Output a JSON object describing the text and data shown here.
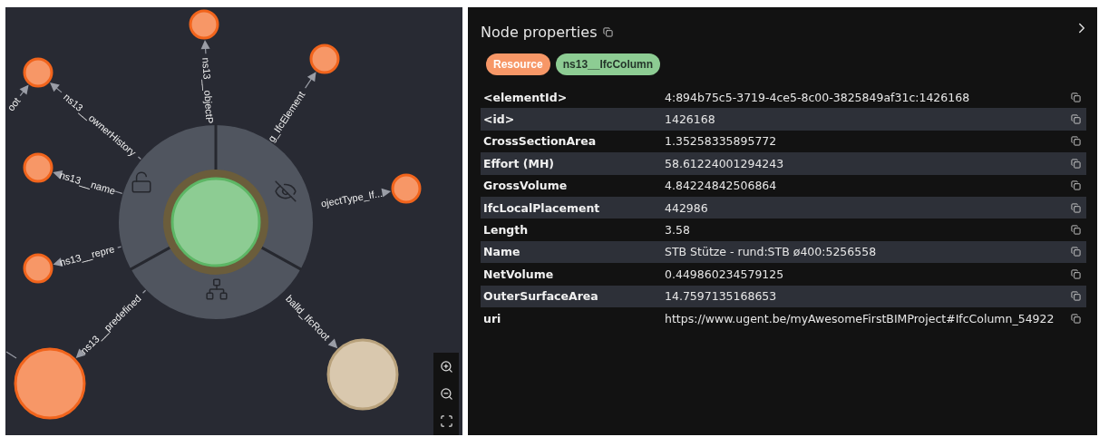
{
  "graph": {
    "center_node": {
      "color": "#8dcc93"
    },
    "nodes": [
      {
        "color": "#f79767"
      },
      {
        "color": "#f79767"
      },
      {
        "color": "#f79767"
      },
      {
        "color": "#f79767"
      },
      {
        "color": "#f79767"
      },
      {
        "color": "#f79767"
      },
      {
        "color": "#f79767"
      },
      {
        "color": "#d9c8ae"
      }
    ],
    "edges": [
      {
        "label": "ns13__objectP"
      },
      {
        "label": "g_IfcElement"
      },
      {
        "label": "ns13__ownerHistory"
      },
      {
        "label": "oot"
      },
      {
        "label": "ns13__name"
      },
      {
        "label": "ojectType_If..."
      },
      {
        "label": "ns13__repre"
      },
      {
        "label": "ns13__predefined"
      },
      {
        "label": "balld_IfcRoot"
      }
    ]
  },
  "panel": {
    "title": "Node properties",
    "labels": [
      {
        "text": "Resource",
        "color": "#f79767"
      },
      {
        "text": "ns13__IfcColumn",
        "color": "#8dcc93"
      }
    ],
    "properties": [
      {
        "key": "<elementId>",
        "value": "4:894b75c5-3719-4ce5-8c00-3825849af31c:1426168"
      },
      {
        "key": "<id>",
        "value": "1426168"
      },
      {
        "key": "CrossSectionArea",
        "value": "1.35258335895772"
      },
      {
        "key": "Effort (MH)",
        "value": "58.61224001294243"
      },
      {
        "key": "GrossVolume",
        "value": "4.84224842506864"
      },
      {
        "key": "IfcLocalPlacement",
        "value": "442986"
      },
      {
        "key": "Length",
        "value": "3.58"
      },
      {
        "key": "Name",
        "value": "STB Stütze - rund:STB ø400:5256558"
      },
      {
        "key": "NetVolume",
        "value": "0.449860234579125"
      },
      {
        "key": "OuterSurfaceArea",
        "value": "14.7597135168653"
      },
      {
        "key": "uri",
        "value": "https://www.ugent.be/myAwesomeFirstBIMProject#IfcColumn_54922"
      }
    ]
  }
}
